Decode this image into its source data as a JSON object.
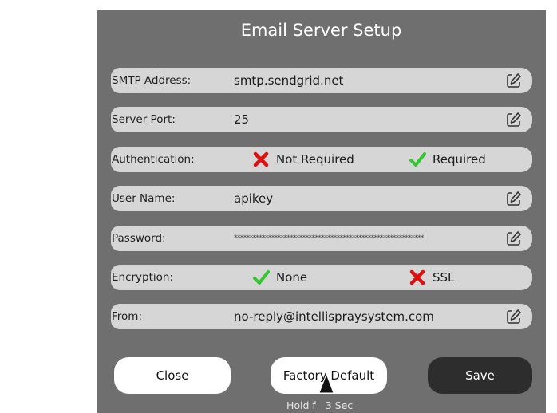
{
  "title": "Email Server Setup",
  "rows": [
    {
      "label": "SMTP Address:",
      "value": "smtp.sendgrid.net"
    },
    {
      "label": "Server Port:",
      "value": "25"
    },
    {
      "label": "Authentication:",
      "options": [
        {
          "icon": "x-icon",
          "text": "Not Required",
          "color": "#e01010"
        },
        {
          "icon": "check-icon",
          "text": "Required",
          "color": "#32c832"
        }
      ]
    },
    {
      "label": "User Name:",
      "value": "apikey"
    },
    {
      "label": "Password:",
      "value": "*************************************************************"
    },
    {
      "label": "Encryption:",
      "options": [
        {
          "icon": "check-icon",
          "text": "None",
          "color": "#32c832"
        },
        {
          "icon": "x-icon",
          "text": "SSL",
          "color": "#e01010"
        }
      ]
    },
    {
      "label": "From:",
      "value": "no-reply@intellispraysystem.com"
    }
  ],
  "buttons": {
    "close": "Close",
    "factory_default": "Factory Default",
    "save": "Save"
  },
  "hint": "Hold f   3 Sec",
  "icons": {
    "edit": "edit-icon",
    "cursor": "cursor-arrow-icon"
  },
  "colors": {
    "panel": "#6f6f6f",
    "field": "#d6d6d6",
    "check": "#32c832",
    "cross": "#e01010"
  }
}
